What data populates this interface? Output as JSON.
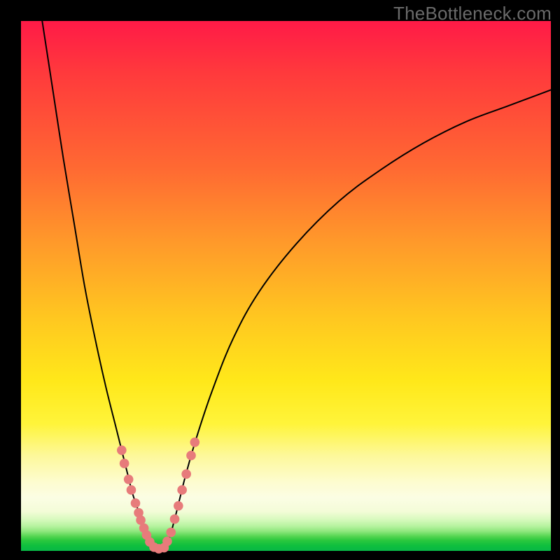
{
  "watermark": "TheBottleneck.com",
  "colors": {
    "marker_fill": "#e77b7b",
    "curve_stroke": "#000000"
  },
  "chart_data": {
    "type": "line",
    "title": "",
    "xlabel": "",
    "ylabel": "",
    "xlim": [
      0,
      100
    ],
    "ylim": [
      0,
      100
    ],
    "grid": false,
    "legend": false,
    "annotations": [],
    "series": [
      {
        "name": "left-curve",
        "x": [
          4,
          6,
          8,
          10,
          12,
          14,
          16,
          18,
          20,
          21,
          22,
          23,
          24,
          25
        ],
        "y": [
          100,
          87,
          74,
          62,
          50,
          40,
          31,
          23,
          15,
          11,
          8,
          5,
          2.5,
          0.5
        ]
      },
      {
        "name": "right-curve",
        "x": [
          27,
          28,
          29,
          30,
          31,
          33,
          36,
          40,
          45,
          52,
          60,
          68,
          76,
          84,
          92,
          100
        ],
        "y": [
          0.5,
          2.5,
          6,
          10,
          14,
          21,
          30,
          40,
          49,
          58,
          66,
          72,
          77,
          81,
          84,
          87
        ]
      }
    ],
    "markers": [
      {
        "series": "left-curve",
        "x": 19.0,
        "y": 19.0
      },
      {
        "series": "left-curve",
        "x": 19.5,
        "y": 16.5
      },
      {
        "series": "left-curve",
        "x": 20.3,
        "y": 13.5
      },
      {
        "series": "left-curve",
        "x": 20.8,
        "y": 11.5
      },
      {
        "series": "left-curve",
        "x": 21.6,
        "y": 9.0
      },
      {
        "series": "left-curve",
        "x": 22.2,
        "y": 7.2
      },
      {
        "series": "left-curve",
        "x": 22.6,
        "y": 5.8
      },
      {
        "series": "left-curve",
        "x": 23.2,
        "y": 4.3
      },
      {
        "series": "left-curve",
        "x": 23.7,
        "y": 3.0
      },
      {
        "series": "left-curve",
        "x": 24.3,
        "y": 1.7
      },
      {
        "series": "left-curve",
        "x": 25.1,
        "y": 0.7
      },
      {
        "series": "left-curve",
        "x": 26.0,
        "y": 0.4
      },
      {
        "series": "right-curve",
        "x": 27.0,
        "y": 0.6
      },
      {
        "series": "right-curve",
        "x": 27.6,
        "y": 1.8
      },
      {
        "series": "right-curve",
        "x": 28.3,
        "y": 3.5
      },
      {
        "series": "right-curve",
        "x": 29.0,
        "y": 6.0
      },
      {
        "series": "right-curve",
        "x": 29.7,
        "y": 8.5
      },
      {
        "series": "right-curve",
        "x": 30.4,
        "y": 11.5
      },
      {
        "series": "right-curve",
        "x": 31.2,
        "y": 14.5
      },
      {
        "series": "right-curve",
        "x": 32.1,
        "y": 18.0
      },
      {
        "series": "right-curve",
        "x": 32.8,
        "y": 20.5
      }
    ],
    "marker_radius_pct": 0.9
  }
}
